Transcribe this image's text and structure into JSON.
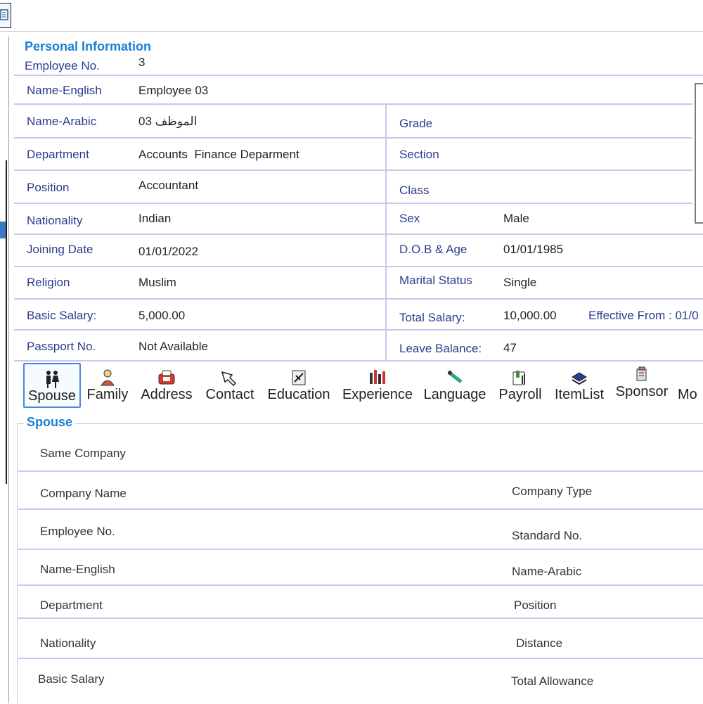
{
  "section_title": "Personal Information",
  "fields": {
    "employee_no": {
      "label": "Employee No.",
      "value": "3"
    },
    "name_english": {
      "label": "Name-English",
      "value": "Employee 03"
    },
    "name_arabic": {
      "label": "Name-Arabic",
      "value": "الموظف 03"
    },
    "grade": {
      "label": "Grade",
      "value": ""
    },
    "department": {
      "label": "Department",
      "value": "Accounts  Finance Deparment"
    },
    "section": {
      "label": "Section",
      "value": ""
    },
    "position": {
      "label": "Position",
      "value": "Accountant"
    },
    "class": {
      "label": "Class",
      "value": ""
    },
    "nationality": {
      "label": "Nationality",
      "value": "Indian"
    },
    "sex": {
      "label": "Sex",
      "value": "Male"
    },
    "joining_date": {
      "label": "Joining Date",
      "value": "01/01/2022"
    },
    "dob_age": {
      "label": "D.O.B & Age",
      "value": "01/01/1985"
    },
    "religion": {
      "label": "Religion",
      "value": "Muslim"
    },
    "marital_status": {
      "label": "Marital Status",
      "value": "Single"
    },
    "basic_salary": {
      "label": "Basic Salary:",
      "value": "5,000.00"
    },
    "total_salary": {
      "label": "Total Salary:",
      "value": "10,000.00"
    },
    "effective_from": {
      "label": "Effective From : 01/0"
    },
    "passport_no": {
      "label": "Passport No.",
      "value": "Not Available"
    },
    "leave_balance": {
      "label": "Leave Balance:",
      "value": "47"
    }
  },
  "tabs": [
    {
      "label": "Spouse",
      "icon": "couple-icon",
      "active": true
    },
    {
      "label": "Family",
      "icon": "family-icon"
    },
    {
      "label": "Address",
      "icon": "address-icon"
    },
    {
      "label": "Contact",
      "icon": "contact-icon"
    },
    {
      "label": "Education",
      "icon": "education-icon"
    },
    {
      "label": "Experience",
      "icon": "experience-icon"
    },
    {
      "label": "Language",
      "icon": "language-icon"
    },
    {
      "label": "Payroll",
      "icon": "payroll-icon"
    },
    {
      "label": "ItemList",
      "icon": "itemlist-icon"
    },
    {
      "label": "Sponsor",
      "icon": "sponsor-icon"
    },
    {
      "label": "Mo",
      "icon": "more-icon"
    }
  ],
  "spouse": {
    "title": "Spouse",
    "same_company": "Same Company",
    "company_name": "Company Name",
    "company_type": "Company Type",
    "employee_no": "Employee No.",
    "standard_no": "Standard No.",
    "name_english": "Name-English",
    "name_arabic": "Name-Arabic",
    "department": "Department",
    "position": "Position",
    "nationality": "Nationality",
    "distance": "Distance",
    "basic_salary": "Basic Salary",
    "total_allowance": "Total Allowance"
  }
}
